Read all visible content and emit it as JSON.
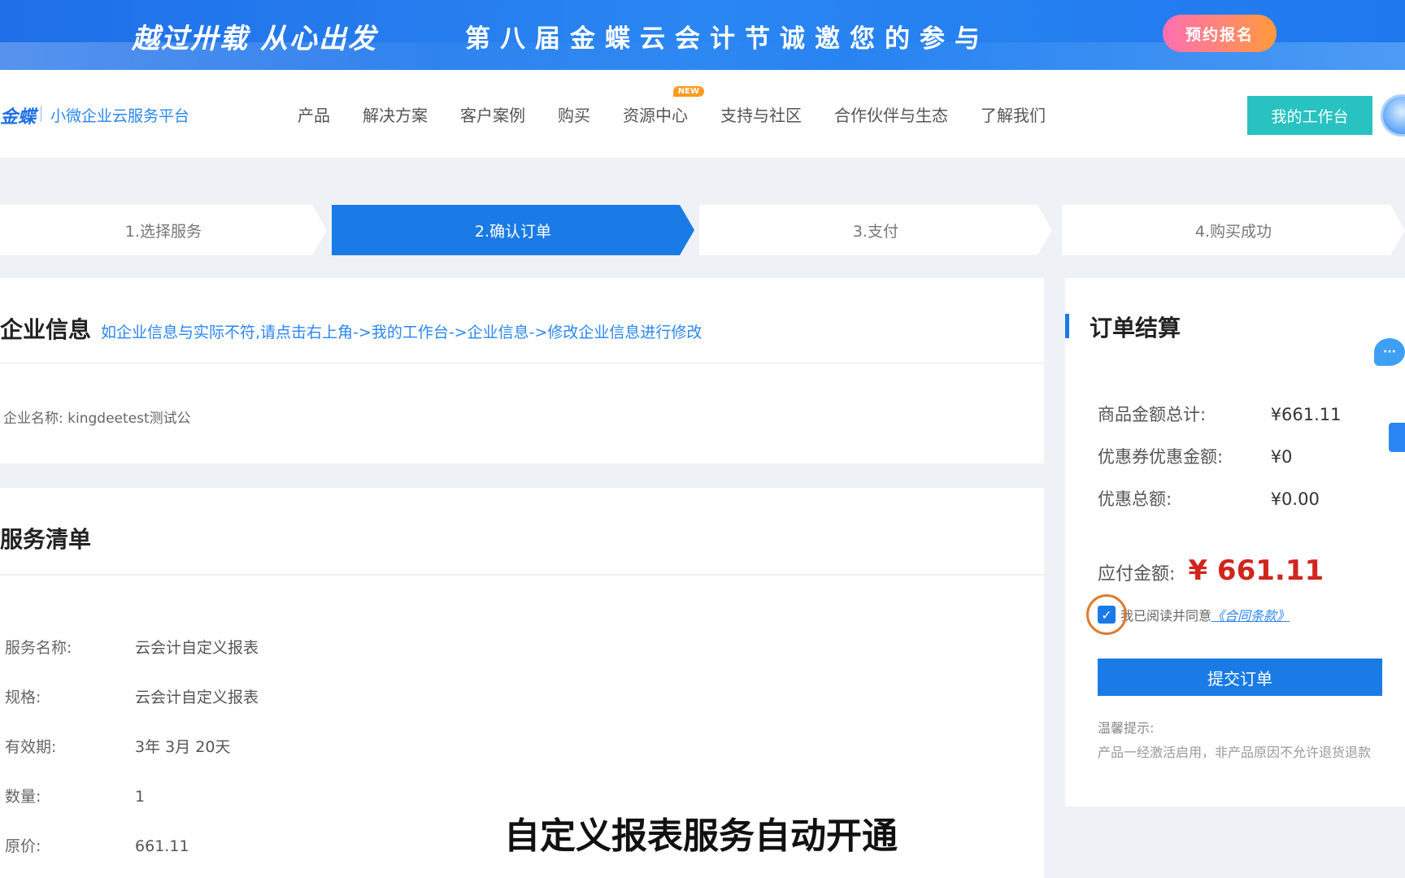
{
  "banner": {
    "slogan_left": "越过卅载 从心出发",
    "slogan_right": "第八届金蝶云会计节诚邀您的参与",
    "cta_label": "预约报名"
  },
  "header": {
    "logo": "金蝶",
    "logo_sub": "小微企业云服务平台",
    "nav": [
      {
        "label": "产品"
      },
      {
        "label": "解决方案"
      },
      {
        "label": "客户案例"
      },
      {
        "label": "购买"
      },
      {
        "label": "资源中心",
        "badge": "NEW"
      },
      {
        "label": "支持与社区"
      },
      {
        "label": "合作伙伴与生态"
      },
      {
        "label": "了解我们"
      }
    ],
    "workspace_button": "我的工作台"
  },
  "steps": [
    {
      "label": "1.选择服务",
      "active": false
    },
    {
      "label": "2.确认订单",
      "active": true
    },
    {
      "label": "3.支付",
      "active": false
    },
    {
      "label": "4.购买成功",
      "active": false
    }
  ],
  "company": {
    "title": "企业信息",
    "hint": "如企业信息与实际不符,请点击右上角->我的工作台->企业信息->修改企业信息进行修改",
    "name_label": "企业名称:",
    "name_value": "kingdeetest测试公"
  },
  "services": {
    "title": "服务清单",
    "rows": [
      {
        "label": "服务名称:",
        "value": "云会计自定义报表"
      },
      {
        "label": "规格:",
        "value": "云会计自定义报表"
      },
      {
        "label": "有效期:",
        "value": "3年 3月 20天"
      },
      {
        "label": "数量:",
        "value": "1"
      },
      {
        "label": "原价:",
        "value": "661.11"
      }
    ]
  },
  "order": {
    "title": "订单结算",
    "rows": [
      {
        "label": "商品金额总计:",
        "value": "¥661.11"
      },
      {
        "label": "优惠券优惠金额:",
        "value": "¥0"
      },
      {
        "label": "优惠总额:",
        "value": "¥0.00"
      }
    ],
    "payable_label": "应付金额:",
    "payable_value": "¥ 661.11",
    "agree_text": "我已阅读并同意",
    "contract_link": "《合同条款》",
    "agreed": true,
    "submit_label": "提交订单",
    "tip_title": "温馨提示:",
    "tip_text": "产品一经激活启用，非产品原因不允许退货退款"
  },
  "subtitle": "自定义报表服务自动开通",
  "colors": {
    "primary": "#1a7be6",
    "teal": "#28c3c0",
    "price_red": "#d0261d"
  }
}
